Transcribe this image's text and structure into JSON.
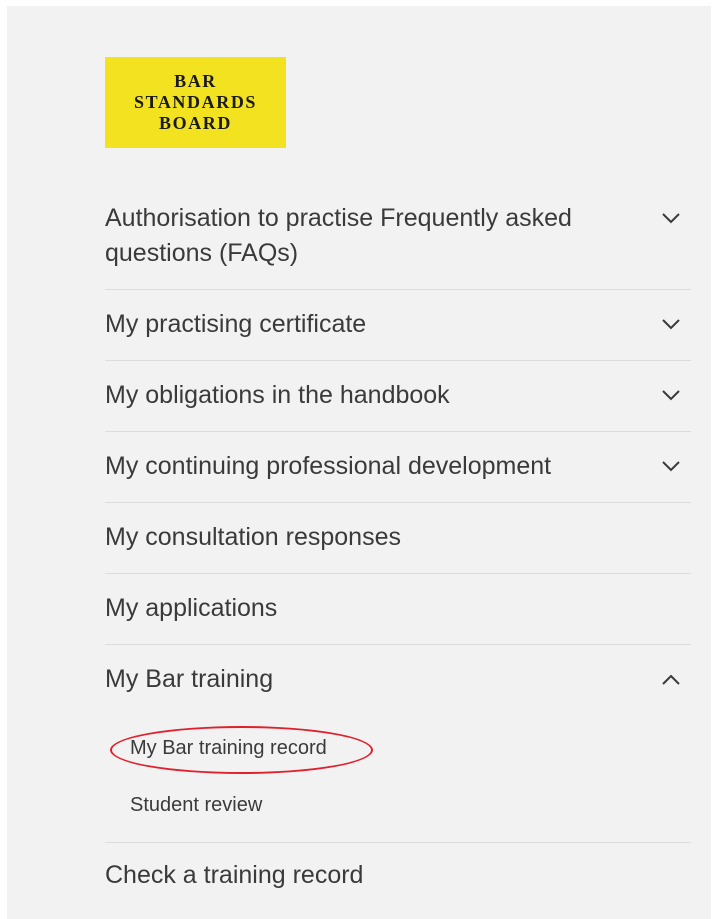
{
  "logo": {
    "lines": [
      "BAR",
      "STANDARDS",
      "BOARD"
    ],
    "background": "#f3e220"
  },
  "nav": {
    "items": [
      {
        "label": "Authorisation to practise Frequently asked questions (FAQs)",
        "chevron": "chevron-down-icon"
      },
      {
        "label": "My practising certificate",
        "chevron": "chevron-down-icon"
      },
      {
        "label": "My obligations in the handbook",
        "chevron": "chevron-down-icon"
      },
      {
        "label": "My continuing professional development",
        "chevron": "chevron-down-icon"
      },
      {
        "label": "My consultation responses"
      },
      {
        "label": "My applications"
      },
      {
        "label": "My Bar training",
        "chevron": "chevron-up-icon",
        "expanded": true,
        "children": [
          {
            "label": "My Bar training record",
            "highlighted": true
          },
          {
            "label": "Student review"
          }
        ]
      },
      {
        "label": "Check a training record"
      }
    ]
  },
  "colors": {
    "panel_bg": "#f2f2f2",
    "text": "#3a3a3a",
    "divider": "#dcdcdc",
    "highlight_ring": "#e0212d"
  }
}
